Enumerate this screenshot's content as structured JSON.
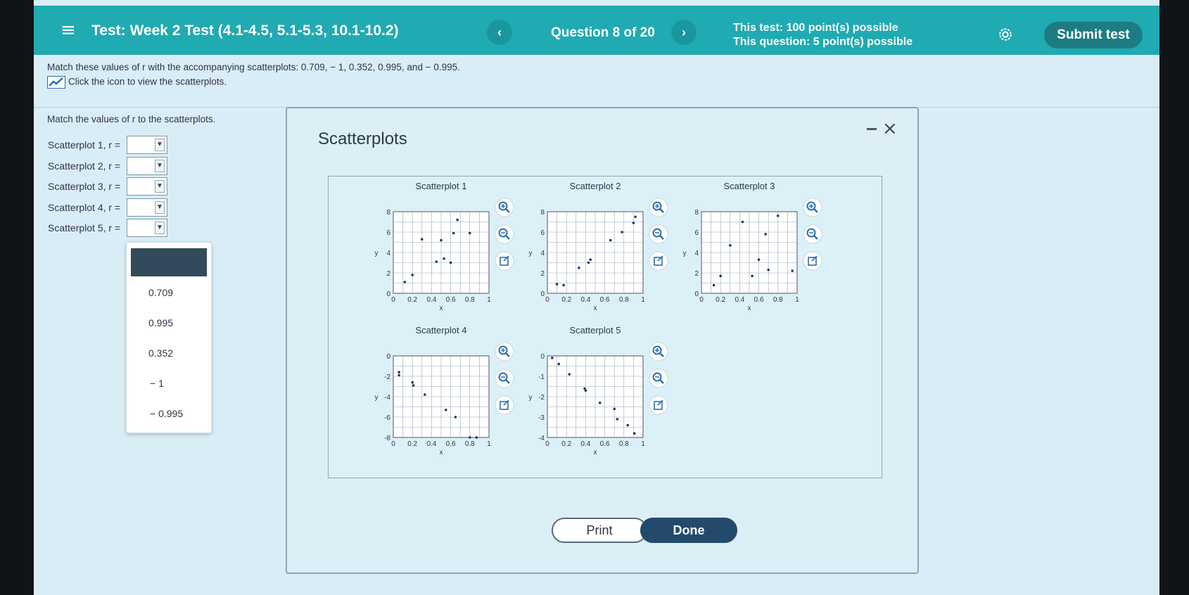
{
  "topbar": {
    "menu_glyph": "≡",
    "title": "Test: Week 2 Test (4.1-4.5, 5.1-5.3, 10.1-10.2)",
    "prev_glyph": "‹",
    "question": "Question 8 of 20",
    "next_glyph": "›",
    "test_points": "This test: 100 point(s) possible",
    "question_points": "This question: 5 point(s) possible",
    "settings_icon": "gear-icon",
    "submit": "Submit test"
  },
  "question": {
    "prompt": "Match these values of r with the accompanying scatterplots: 0.709, − 1, 0.352, 0.995, and − 0.995.",
    "icon_link": "Click the icon to view the scatterplots.",
    "match_label": "Match the values of r to the scatterplots.",
    "rows": [
      {
        "label": "Scatterplot 1, r ="
      },
      {
        "label": "Scatterplot 2, r ="
      },
      {
        "label": "Scatterplot 3, r ="
      },
      {
        "label": "Scatterplot 4, r ="
      },
      {
        "label": "Scatterplot 5, r ="
      }
    ],
    "dropdown_arrow": "▼",
    "options": [
      "0.709",
      "0.995",
      "0.352",
      "− 1",
      "− 0.995"
    ]
  },
  "modal": {
    "title": "Scatterplots",
    "close": "×",
    "print": "Print",
    "done": "Done"
  },
  "chart_data": [
    {
      "type": "scatter",
      "title": "Scatterplot 1",
      "xlabel": "x",
      "ylabel": "y",
      "xlim": [
        0,
        1
      ],
      "ylim": [
        0,
        8
      ],
      "xticks": [
        "0",
        "0.2",
        "0.4",
        "0.6",
        "0.8",
        "1"
      ],
      "yticks": [
        "0",
        "2",
        "4",
        "6",
        "8"
      ],
      "x": [
        0.12,
        0.2,
        0.3,
        0.45,
        0.5,
        0.53,
        0.6,
        0.63,
        0.67,
        0.8
      ],
      "y": [
        1.1,
        1.8,
        5.3,
        3.1,
        5.2,
        3.4,
        3.0,
        5.9,
        7.2,
        5.9
      ]
    },
    {
      "type": "scatter",
      "title": "Scatterplot 2",
      "xlabel": "x",
      "ylabel": "y",
      "xlim": [
        0,
        1
      ],
      "ylim": [
        0,
        8
      ],
      "xticks": [
        "0",
        "0.2",
        "0.4",
        "0.6",
        "0.8",
        "1"
      ],
      "yticks": [
        "0",
        "2",
        "4",
        "6",
        "8"
      ],
      "x": [
        0.1,
        0.17,
        0.33,
        0.43,
        0.45,
        0.66,
        0.78,
        0.9,
        0.92
      ],
      "y": [
        0.9,
        0.8,
        2.5,
        3.0,
        3.3,
        5.2,
        6.0,
        6.9,
        7.5
      ]
    },
    {
      "type": "scatter",
      "title": "Scatterplot 3",
      "xlabel": "x",
      "ylabel": "y",
      "xlim": [
        0,
        1
      ],
      "ylim": [
        0,
        8
      ],
      "xticks": [
        "0",
        "0.2",
        "0.4",
        "0.6",
        "0.8",
        "1"
      ],
      "yticks": [
        "0",
        "2",
        "4",
        "6",
        "8"
      ],
      "x": [
        0.13,
        0.2,
        0.3,
        0.43,
        0.53,
        0.6,
        0.67,
        0.7,
        0.8,
        0.95
      ],
      "y": [
        0.8,
        1.7,
        4.7,
        7.0,
        1.7,
        3.3,
        5.8,
        2.3,
        7.6,
        2.2
      ]
    },
    {
      "type": "scatter",
      "title": "Scatterplot 4",
      "xlabel": "x",
      "ylabel": "y",
      "xlim": [
        0,
        1
      ],
      "ylim": [
        -8,
        0
      ],
      "xticks": [
        "0",
        "0.2",
        "0.4",
        "0.6",
        "0.8",
        "1"
      ],
      "yticks": [
        "0",
        "-2",
        "-4",
        "-6",
        "-8"
      ],
      "x": [
        0.06,
        0.06,
        0.2,
        0.21,
        0.33,
        0.55,
        0.65,
        0.8,
        0.87
      ],
      "y": [
        -1.6,
        -1.9,
        -2.6,
        -2.9,
        -3.8,
        -5.3,
        -6.0,
        -8.0,
        -8.0
      ]
    },
    {
      "type": "scatter",
      "title": "Scatterplot 5",
      "xlabel": "x",
      "ylabel": "y",
      "xlim": [
        0,
        1
      ],
      "ylim": [
        -4,
        0
      ],
      "xticks": [
        "0",
        "0.2",
        "0.4",
        "0.6",
        "0.8",
        "1"
      ],
      "yticks": [
        "0",
        "-1",
        "-2",
        "-3",
        "-4"
      ],
      "x": [
        0.05,
        0.12,
        0.23,
        0.39,
        0.4,
        0.55,
        0.7,
        0.73,
        0.84,
        0.91
      ],
      "y": [
        -0.1,
        -0.4,
        -0.9,
        -1.6,
        -1.7,
        -2.3,
        -2.6,
        -3.1,
        -3.4,
        -3.8
      ]
    }
  ]
}
